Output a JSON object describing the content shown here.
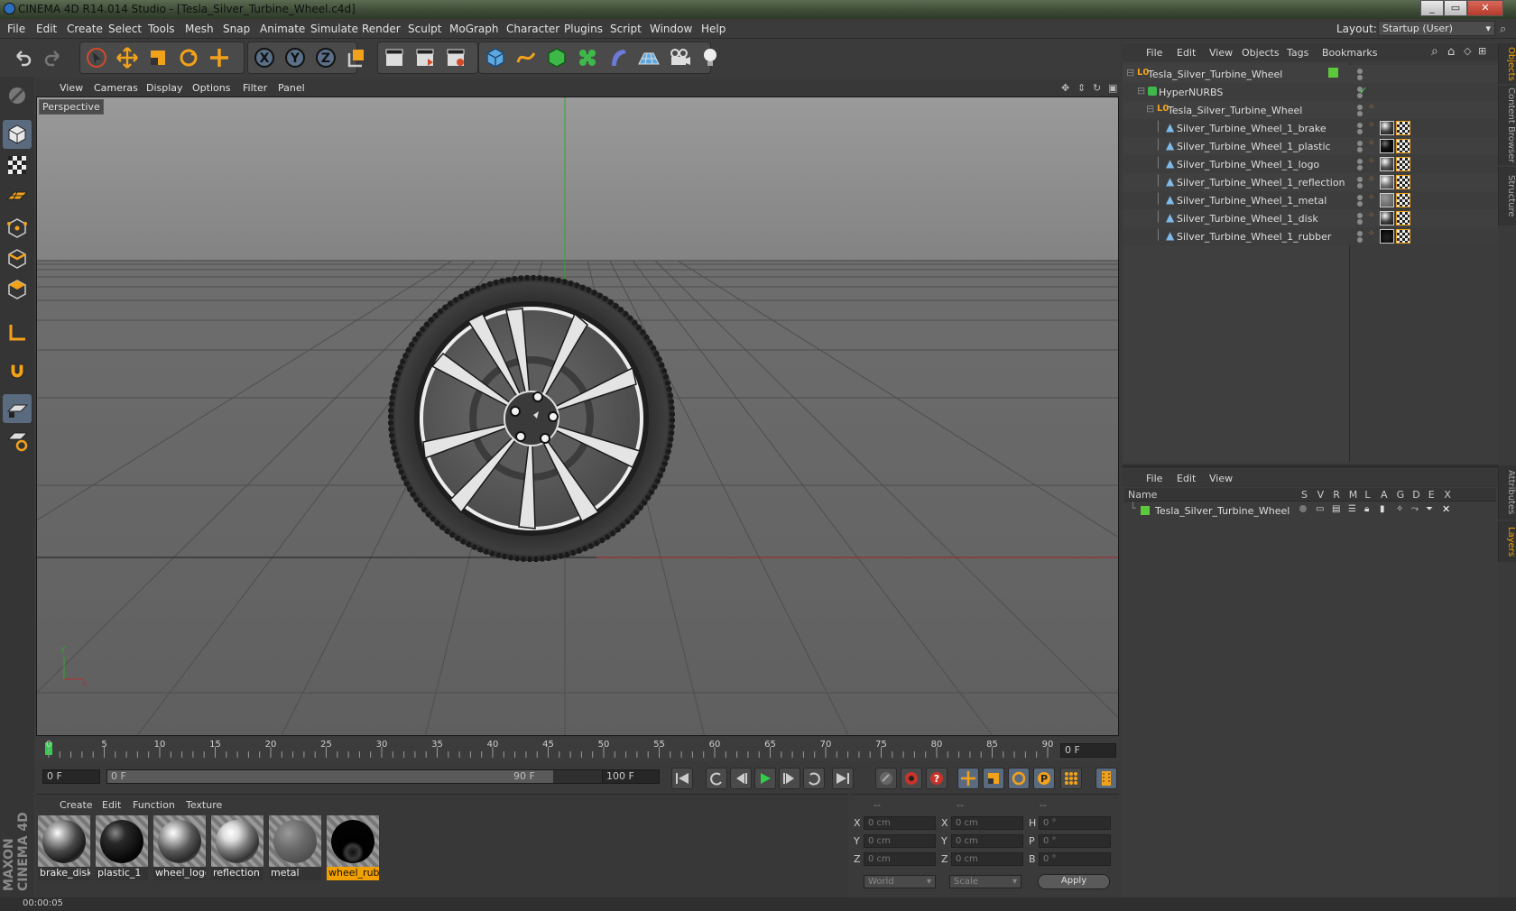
{
  "window": {
    "title": "CINEMA 4D R14.014 Studio - [Tesla_Silver_Turbine_Wheel.c4d]",
    "min": "_",
    "max": "▭",
    "close": "✕"
  },
  "menu": [
    "File",
    "Edit",
    "Create",
    "Select",
    "Tools",
    "Mesh",
    "Snap",
    "Animate",
    "Simulate",
    "Render",
    "Sculpt",
    "MoGraph",
    "Character",
    "Plugins",
    "Script",
    "Window",
    "Help"
  ],
  "layout": {
    "label": "Layout:",
    "value": "Startup (User)"
  },
  "viewport": {
    "menu": [
      "View",
      "Cameras",
      "Display",
      "Options",
      "Filter",
      "Panel"
    ],
    "label": "Perspective"
  },
  "timeline": {
    "ticks": [
      "0",
      "5",
      "10",
      "15",
      "20",
      "25",
      "30",
      "35",
      "40",
      "45",
      "50",
      "55",
      "60",
      "65",
      "70",
      "75",
      "80",
      "85",
      "90"
    ],
    "frame_field": "0 F"
  },
  "transport": {
    "start": "0 F",
    "range_start": "0 F",
    "range_end": "90 F",
    "end": "100 F"
  },
  "materials": {
    "menu": [
      "Create",
      "Edit",
      "Function",
      "Texture"
    ],
    "items": [
      "brake_disk",
      "plastic_1",
      "wheel_logo",
      "reflection",
      "metal",
      "wheel_rubl"
    ]
  },
  "coords": {
    "headers": [
      "--",
      "--",
      "--"
    ],
    "rows": [
      {
        "a": "X",
        "av": "0 cm",
        "b": "X",
        "bv": "0 cm",
        "c": "H",
        "cv": "0 °"
      },
      {
        "a": "Y",
        "av": "0 cm",
        "b": "Y",
        "bv": "0 cm",
        "c": "P",
        "cv": "0 °"
      },
      {
        "a": "Z",
        "av": "0 cm",
        "b": "Z",
        "bv": "0 cm",
        "c": "B",
        "cv": "0 °"
      }
    ],
    "world": "World",
    "scale": "Scale",
    "apply": "Apply"
  },
  "status": "00:00:05",
  "objects": {
    "menu": [
      "File",
      "Edit",
      "View",
      "Objects",
      "Tags",
      "Bookmarks"
    ],
    "tree": [
      "Tesla_Silver_Turbine_Wheel",
      "HyperNURBS",
      "Tesla_Silver_Turbine_Wheel",
      "Silver_Turbine_Wheel_1_brake",
      "Silver_Turbine_Wheel_1_plastic",
      "Silver_Turbine_Wheel_1_logo",
      "Silver_Turbine_Wheel_1_reflection",
      "Silver_Turbine_Wheel_1_metal",
      "Silver_Turbine_Wheel_1_disk",
      "Silver_Turbine_Wheel_1_rubber"
    ]
  },
  "layers": {
    "menu": [
      "File",
      "Edit",
      "View"
    ],
    "name_header": "Name",
    "cols": [
      "S",
      "V",
      "R",
      "M",
      "L",
      "A",
      "G",
      "D",
      "E",
      "X"
    ],
    "row": "Tesla_Silver_Turbine_Wheel"
  },
  "side_tabs": [
    "Objects",
    "Content Browser",
    "Structure",
    "Attributes",
    "Layers"
  ],
  "brand": "MAXON CINEMA 4D"
}
